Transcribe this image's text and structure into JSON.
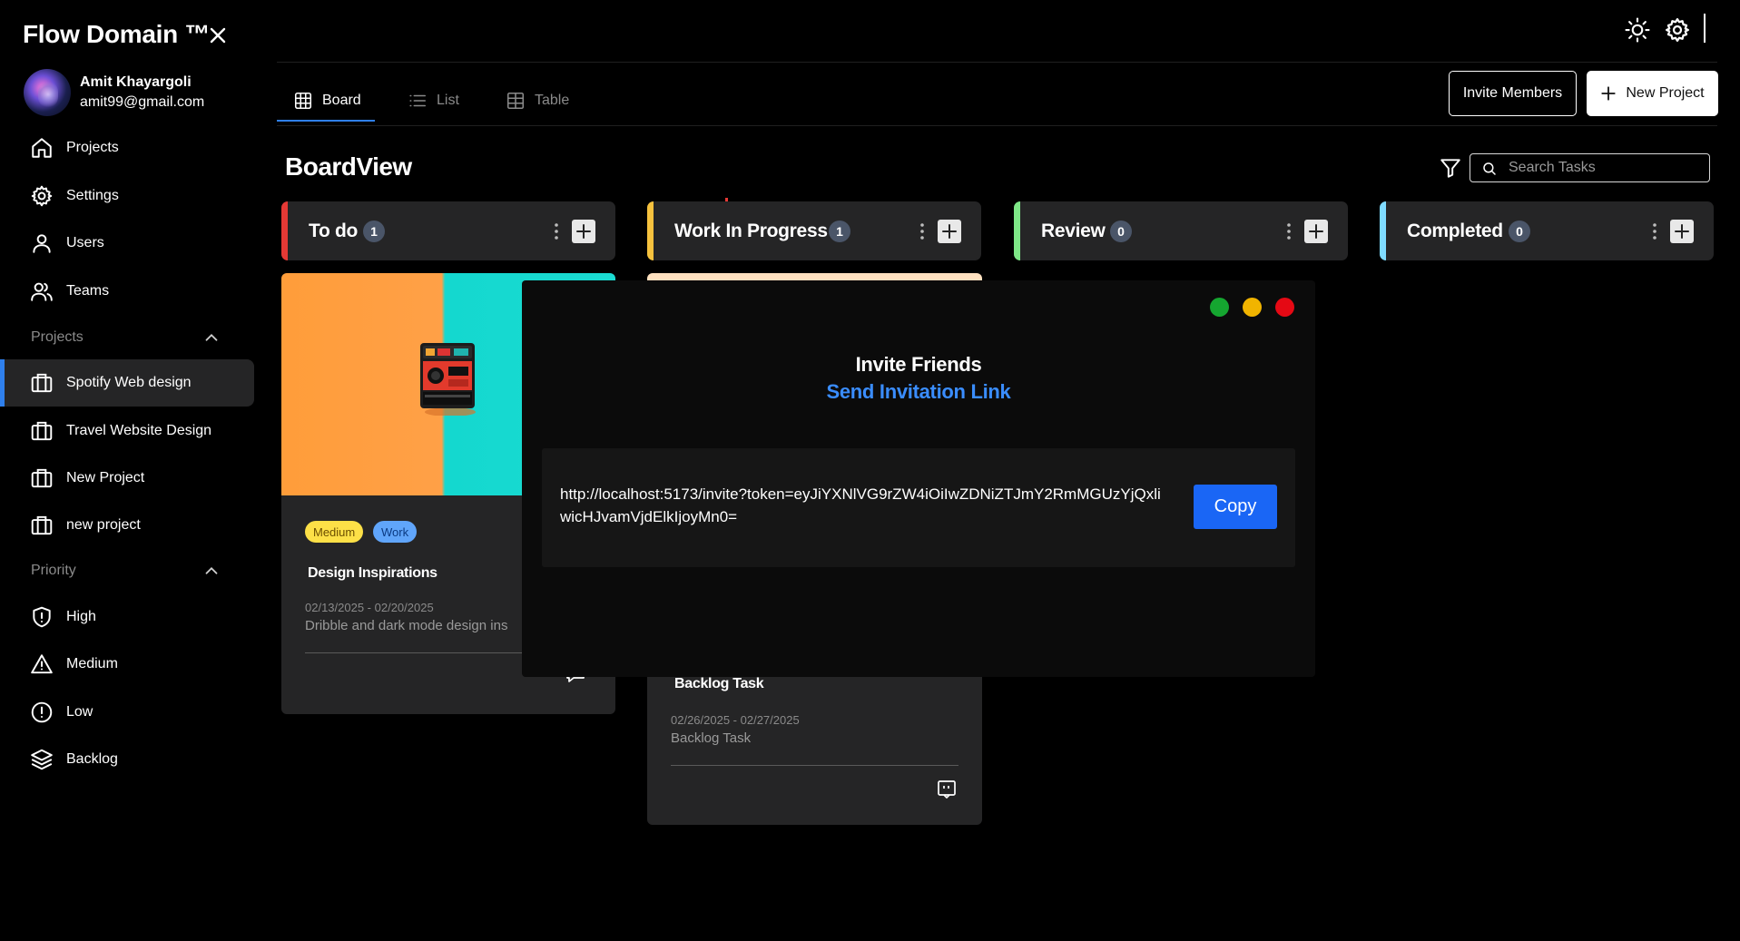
{
  "app": {
    "title": "Flow Domain ™"
  },
  "user": {
    "name": "Amit Khayargoli",
    "email": "amit99@gmail.com"
  },
  "sidebar": {
    "main_items": [
      {
        "label": "Projects",
        "icon": "home-icon"
      },
      {
        "label": "Settings",
        "icon": "gear-icon"
      },
      {
        "label": "Users",
        "icon": "user-icon"
      },
      {
        "label": "Teams",
        "icon": "users-icon"
      }
    ],
    "projects_section": "Projects",
    "projects": [
      {
        "label": "Spotify Web design",
        "active": true
      },
      {
        "label": "Travel Website Design",
        "active": false
      },
      {
        "label": "New Project",
        "active": false
      },
      {
        "label": "new project",
        "active": false
      }
    ],
    "priority_section": "Priority",
    "priorities": [
      {
        "label": "High",
        "icon": "shield-alert-icon"
      },
      {
        "label": "Medium",
        "icon": "triangle-alert-icon"
      },
      {
        "label": "Low",
        "icon": "circle-alert-icon"
      },
      {
        "label": "Backlog",
        "icon": "layers-icon"
      }
    ]
  },
  "tabs": [
    {
      "label": "Board",
      "active": true
    },
    {
      "label": "List",
      "active": false
    },
    {
      "label": "Table",
      "active": false
    }
  ],
  "header": {
    "invite_label": "Invite Members",
    "new_project_label": "New Project"
  },
  "board": {
    "title": "BoardView",
    "search_placeholder": "Search Tasks",
    "columns": [
      {
        "title": "To do",
        "count": "1",
        "color": "#e53935"
      },
      {
        "title": "Work In Progress",
        "count": "1",
        "color": "#f6c23e"
      },
      {
        "title": "Review",
        "count": "0",
        "color": "#7ee787"
      },
      {
        "title": "Completed",
        "count": "0",
        "color": "#7fdbff"
      }
    ],
    "cards": [
      {
        "tags": [
          "Medium",
          "Work"
        ],
        "title": "Design Inspirations",
        "dates": "02/13/2025 - 02/20/2025",
        "description": "Dribble and dark mode design ins"
      },
      {
        "title": "Backlog Task",
        "dates": "02/26/2025 - 02/27/2025",
        "description": "Backlog Task"
      }
    ]
  },
  "modal": {
    "title": "Invite Friends",
    "subtitle": "Send Invitation Link",
    "link": "http://localhost:5173/invite?token=eyJiYXNlVG9rZW4iOiIwZDNiZTJmY2RmMGUzYjQxliwicHJvamVjdElkIjoyMn0=",
    "copy_label": "Copy",
    "dot_colors": [
      "#15a630",
      "#f1b400",
      "#e50914"
    ]
  },
  "colors": {
    "accent": "#2f80ed",
    "tag_medium_bg": "#fde047",
    "tag_work_bg": "#60a5fa"
  }
}
